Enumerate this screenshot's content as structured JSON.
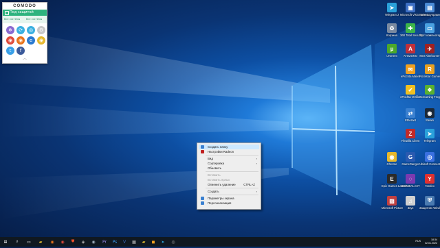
{
  "comodo": {
    "logo": "COMODO",
    "status": "Под защитой",
    "sub_left": "Все системы",
    "sub_right": "Все системы",
    "tiles": [
      {
        "name": "snowflake",
        "glyph": "❄",
        "color": "#8a6ad0"
      },
      {
        "name": "refresh",
        "glyph": "⟳",
        "color": "#3ab0e0"
      },
      {
        "name": "scan",
        "glyph": "◎",
        "color": "#3ab0e0"
      },
      {
        "name": "settings",
        "glyph": "⚙",
        "color": "#c8c8c8"
      },
      {
        "name": "comodo-dragon",
        "glyph": "◉",
        "color": "#e04a3a"
      },
      {
        "name": "firefox",
        "glyph": "◉",
        "color": "#e8731a"
      },
      {
        "name": "ie",
        "glyph": "e",
        "color": "#2a7ad0"
      },
      {
        "name": "chrome",
        "glyph": "◉",
        "color": "#e6b82c"
      },
      {
        "name": "twitter",
        "glyph": "t",
        "color": "#39a0e8"
      },
      {
        "name": "facebook",
        "glyph": "f",
        "color": "#3b5a9a"
      }
    ]
  },
  "desktop_icons": [
    {
      "label": "Telegram 2",
      "color": "#2aa1da",
      "glyph": "➤",
      "col": 0,
      "row": 0
    },
    {
      "label": "Microsoft Visio Suite 22",
      "color": "#3d6fc4",
      "glyph": "▣",
      "col": 1,
      "row": 0
    },
    {
      "label": "Панель управления",
      "color": "#4a8ad4",
      "glyph": "▤",
      "col": 2,
      "row": 0
    },
    {
      "label": "Корзина",
      "color": "#7a8aa0",
      "glyph": "♻",
      "col": 0,
      "row": 1
    },
    {
      "label": "360 Total Security",
      "color": "#3cb54a",
      "glyph": "✚",
      "col": 1,
      "row": 1
    },
    {
      "label": "Этот компьютер",
      "color": "#4aa0e0",
      "glyph": "▭",
      "col": 2,
      "row": 1
    },
    {
      "label": "uTorrent",
      "color": "#4ca82a",
      "glyph": "µ",
      "col": 0,
      "row": 2
    },
    {
      "label": "ATOZONO",
      "color": "#c0303a",
      "glyph": "A",
      "col": 1,
      "row": 2
    },
    {
      "label": "MSI Afterburner",
      "color": "#a02020",
      "glyph": "✈",
      "col": 2,
      "row": 2
    },
    {
      "label": "ePochta Mailer",
      "color": "#f0a020",
      "glyph": "✉",
      "col": 1,
      "row": 3
    },
    {
      "label": "Rockstar Games ...",
      "color": "#e8a020",
      "glyph": "R",
      "col": 2,
      "row": 3
    },
    {
      "label": "ePochta Verifier",
      "color": "#f0c020",
      "glyph": "✔",
      "col": 1,
      "row": 4
    },
    {
      "label": "Screaming Frog SE...",
      "color": "#5ab030",
      "glyph": "❖",
      "col": 2,
      "row": 4
    },
    {
      "label": "Ethernet",
      "color": "#3a80d0",
      "glyph": "⇄",
      "col": 1,
      "row": 5
    },
    {
      "label": "Steam",
      "color": "#1b2838",
      "glyph": "◉",
      "col": 2,
      "row": 5
    },
    {
      "label": "FileZilla Client",
      "color": "#c02a2a",
      "glyph": "Z",
      "col": 1,
      "row": 6
    },
    {
      "label": "Telegram",
      "color": "#2aa1da",
      "glyph": "➤",
      "col": 2,
      "row": 6
    },
    {
      "label": "Chrome",
      "color": "#e6b82c",
      "glyph": "◉",
      "col": 0,
      "row": 7
    },
    {
      "label": "GameRanger",
      "color": "#2a5ab0",
      "glyph": "G",
      "col": 1,
      "row": 7
    },
    {
      "label": "Ubisoft Connect",
      "color": "#3a70e0",
      "glyph": "◎",
      "col": 2,
      "row": 7
    },
    {
      "label": "Epic Games Launcher",
      "color": "#2a2a2a",
      "glyph": "E",
      "col": 0,
      "row": 8
    },
    {
      "label": "GOG GALAXY",
      "color": "#7a3ab0",
      "glyph": "◌",
      "col": 1,
      "row": 8
    },
    {
      "label": "Yandex",
      "color": "#e03030",
      "glyph": "Y",
      "col": 2,
      "row": 8
    },
    {
      "label": "Microsoft Picture",
      "color": "#c04040",
      "glyph": "▨",
      "col": 0,
      "row": 9
    },
    {
      "label": "Звук",
      "color": "#d0d0d0",
      "glyph": "♫",
      "col": 1,
      "row": 9
    },
    {
      "label": "Защитник Windows",
      "color": "#4a7ab0",
      "glyph": "⛨",
      "col": 2,
      "row": 9
    }
  ],
  "context_menu": {
    "items": [
      {
        "label": "Создать папку",
        "type": "item",
        "highlight": true,
        "icon": "#3a80d0"
      },
      {
        "label": "Настройки Radeon",
        "type": "item",
        "icon": "#c02020"
      },
      {
        "type": "separator"
      },
      {
        "label": "Вид",
        "type": "submenu"
      },
      {
        "label": "Сортировка",
        "type": "submenu"
      },
      {
        "label": "Обновить",
        "type": "item"
      },
      {
        "type": "separator"
      },
      {
        "label": "Вставить",
        "type": "item",
        "disabled": true
      },
      {
        "label": "Вставить ярлык",
        "type": "item",
        "disabled": true
      },
      {
        "label": "Отменить удаление",
        "type": "item",
        "shortcut": "CTRL+Z"
      },
      {
        "type": "separator"
      },
      {
        "label": "Создать",
        "type": "submenu"
      },
      {
        "type": "separator"
      },
      {
        "label": "Параметры экрана",
        "type": "item",
        "icon": "#3a80d0"
      },
      {
        "label": "Персонализация",
        "type": "item",
        "icon": "#3a80d0"
      }
    ]
  },
  "taskbar": {
    "apps": [
      {
        "name": "start",
        "glyph": "⊞",
        "color": "#ffffff"
      },
      {
        "name": "search",
        "glyph": "⌕",
        "color": "#ffffff"
      },
      {
        "name": "task-view",
        "glyph": "▭",
        "color": "#ffffff"
      },
      {
        "name": "explorer",
        "glyph": "▰",
        "color": "#e8c030"
      },
      {
        "name": "firefox",
        "glyph": "◉",
        "color": "#e8731a"
      },
      {
        "name": "dragon",
        "glyph": "◉",
        "color": "#e04a3a"
      },
      {
        "name": "brave",
        "glyph": "⛊",
        "color": "#f0502a"
      },
      {
        "name": "app",
        "glyph": "◈",
        "color": "#c0c0c0"
      },
      {
        "name": "steam",
        "glyph": "◉",
        "color": "#a0b0c0"
      },
      {
        "name": "premiere",
        "glyph": "Pr",
        "color": "#9a8af0"
      },
      {
        "name": "photoshop",
        "glyph": "Ps",
        "color": "#3a9af0"
      },
      {
        "name": "visio",
        "glyph": "V",
        "color": "#3d6fc4"
      },
      {
        "name": "app2",
        "glyph": "▦",
        "color": "#c0c0c0"
      },
      {
        "name": "folder",
        "glyph": "▰",
        "color": "#e8c030"
      },
      {
        "name": "app3",
        "glyph": "◼",
        "color": "#f0a020"
      },
      {
        "name": "telegram",
        "glyph": "➤",
        "color": "#2aa1da"
      },
      {
        "name": "app4",
        "glyph": "◎",
        "color": "#a0a0a0"
      }
    ],
    "lang": "RUS",
    "time": "18:34",
    "date": "02.01.2022"
  }
}
